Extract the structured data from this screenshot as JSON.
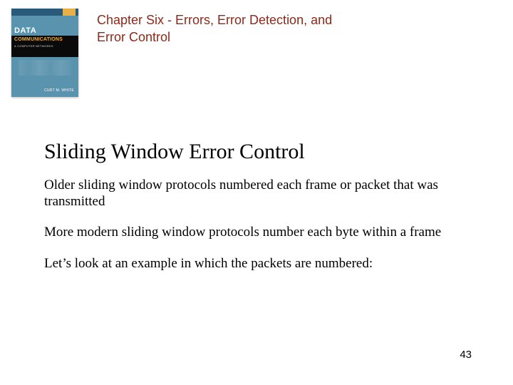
{
  "book_cover": {
    "title1": "DATA",
    "title2": "COMMUNICATIONS",
    "subtitle": "& COMPUTER NETWORKS",
    "author": "CURT M. WHITE"
  },
  "chapter_title": "Chapter Six - Errors, Error Detection, and Error Control",
  "slide_title": "Sliding Window Error Control",
  "paragraphs": [
    "Older sliding window protocols numbered each frame or packet that was transmitted",
    "More modern sliding window protocols number each byte within a frame",
    "Let’s look at an example in which the packets are numbered:"
  ],
  "page_number": "43"
}
